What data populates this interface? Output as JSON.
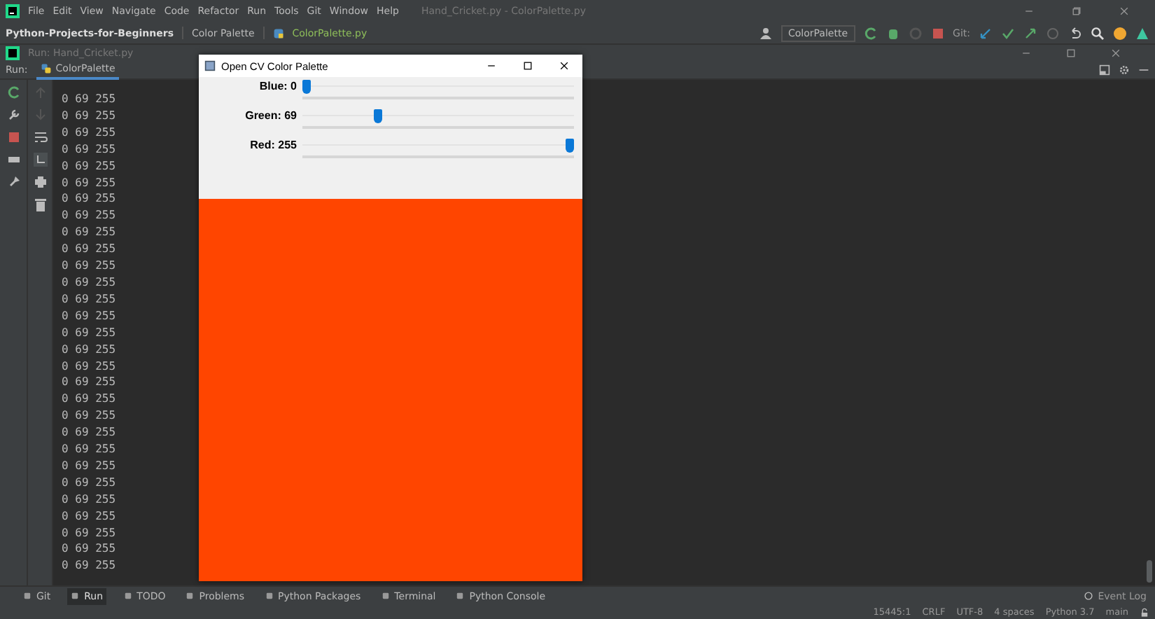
{
  "menu_bar": {
    "items": [
      "File",
      "Edit",
      "View",
      "Navigate",
      "Code",
      "Refactor",
      "Run",
      "Tools",
      "Git",
      "Window",
      "Help"
    ],
    "title": "Hand_Cricket.py - ColorPalette.py"
  },
  "breadcrumb": [
    "Python-Projects-for-Beginners",
    "Color Palette",
    "ColorPalette.py"
  ],
  "toolbar": {
    "run_config": "ColorPalette",
    "git_label": "Git:"
  },
  "run_window": {
    "title": "Run: Hand_Cricket.py",
    "tab_label": "Run:",
    "tab": "ColorPalette",
    "console_lines": [
      "0 69 255",
      "0 69 255",
      "0 69 255",
      "0 69 255",
      "0 69 255",
      "0 69 255",
      "0 69 255",
      "0 69 255",
      "0 69 255",
      "0 69 255",
      "0 69 255",
      "0 69 255",
      "0 69 255",
      "0 69 255",
      "0 69 255",
      "0 69 255",
      "0 69 255",
      "0 69 255",
      "0 69 255",
      "0 69 255",
      "0 69 255",
      "0 69 255",
      "0 69 255",
      "0 69 255",
      "0 69 255",
      "0 69 255",
      "0 69 255",
      "0 69 255",
      "0 69 255"
    ]
  },
  "cv_window": {
    "title": "Open CV Color Palette",
    "trackbars": [
      {
        "label": "Blue: 0",
        "level": 0
      },
      {
        "label": "Green: 69",
        "level": 0.2706
      },
      {
        "label": "Red: 255",
        "level": 1
      }
    ]
  },
  "bottom_tabs": [
    {
      "label": "Git",
      "selected": false
    },
    {
      "label": "Run",
      "selected": true
    },
    {
      "label": "TODO",
      "selected": false
    },
    {
      "label": "Problems",
      "selected": false
    },
    {
      "label": "Python Packages",
      "selected": false
    },
    {
      "label": "Terminal",
      "selected": false
    },
    {
      "label": "Python Console",
      "selected": false
    }
  ],
  "event_log": "Event Log",
  "status_bar": [
    "15445:1",
    "CRLF",
    "UTF-8",
    "4 spaces",
    "Python 3.7",
    "main"
  ]
}
